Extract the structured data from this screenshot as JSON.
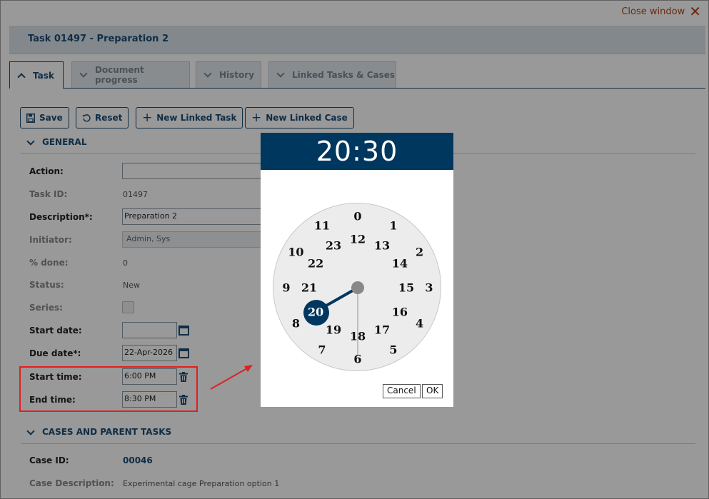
{
  "window": {
    "close_label": "Close window"
  },
  "title": "Task 01497 - Preparation 2",
  "tabs": [
    {
      "label": "Task"
    },
    {
      "label": "Document progress"
    },
    {
      "label": "History"
    },
    {
      "label": "Linked Tasks & Cases"
    }
  ],
  "toolbar": {
    "save": "Save",
    "reset": "Reset",
    "new_linked_task": "New Linked Task",
    "new_linked_case": "New Linked Case"
  },
  "general": {
    "header": "GENERAL",
    "action_label": "Action:",
    "action_value": "",
    "task_id_label": "Task ID:",
    "task_id": "01497",
    "description_label": "Description*:",
    "description": "Preparation 2",
    "initiator_label": "Initiator:",
    "initiator": "Admin, Sys",
    "done_label": "% done:",
    "done": "0",
    "status_label": "Status:",
    "status": "New",
    "series_label": "Series:",
    "start_date_label": "Start date:",
    "start_date": "",
    "due_date_label": "Due date*:",
    "due_date": "22-Apr-2026",
    "start_time_label": "Start time:",
    "start_time": "6:00 PM",
    "end_time_label": "End time:",
    "end_time": "8:30 PM"
  },
  "cases": {
    "header": "CASES AND PARENT TASKS",
    "case_id_label": "Case ID:",
    "case_id": "00046",
    "case_desc_label": "Case Description:",
    "case_desc": "Experimental cage Preparation option 1"
  },
  "time_picker": {
    "display": "20:30",
    "selected_hour": "20",
    "outer_hours": [
      "0",
      "1",
      "2",
      "3",
      "4",
      "5",
      "6",
      "7",
      "8",
      "9",
      "10",
      "11"
    ],
    "inner_hours": [
      "12",
      "13",
      "14",
      "15",
      "16",
      "17",
      "18",
      "19",
      "20",
      "21",
      "22",
      "23"
    ],
    "cancel": "Cancel",
    "ok": "OK"
  },
  "colors": {
    "brand": "#00375f",
    "label_blue": "#1b4b73",
    "highlight": "#e0201e",
    "close_text": "#b0461e"
  }
}
